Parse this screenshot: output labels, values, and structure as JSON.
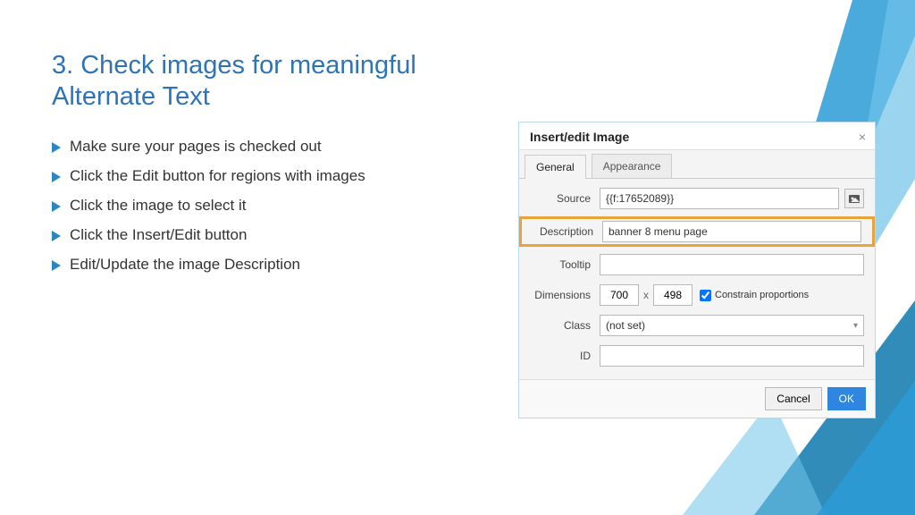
{
  "title": "3. Check images for meaningful Alternate Text",
  "bullets": [
    "Make sure your pages is checked out",
    "Click the Edit button for regions with images",
    "Click the image to select it",
    "Click the Insert/Edit button",
    "Edit/Update the image Description"
  ],
  "dialog": {
    "title": "Insert/edit Image",
    "tabs": {
      "general": "General",
      "appearance": "Appearance"
    },
    "labels": {
      "source": "Source",
      "description": "Description",
      "tooltip": "Tooltip",
      "dimensions": "Dimensions",
      "class": "Class",
      "id": "ID",
      "constrain": "Constrain proportions"
    },
    "values": {
      "source": "{{f:17652089}}",
      "description": "banner 8 menu page",
      "tooltip": "",
      "width": "700",
      "height": "498",
      "class": "(not set)",
      "id": "",
      "constrain_checked": true
    },
    "buttons": {
      "cancel": "Cancel",
      "ok": "OK"
    }
  }
}
